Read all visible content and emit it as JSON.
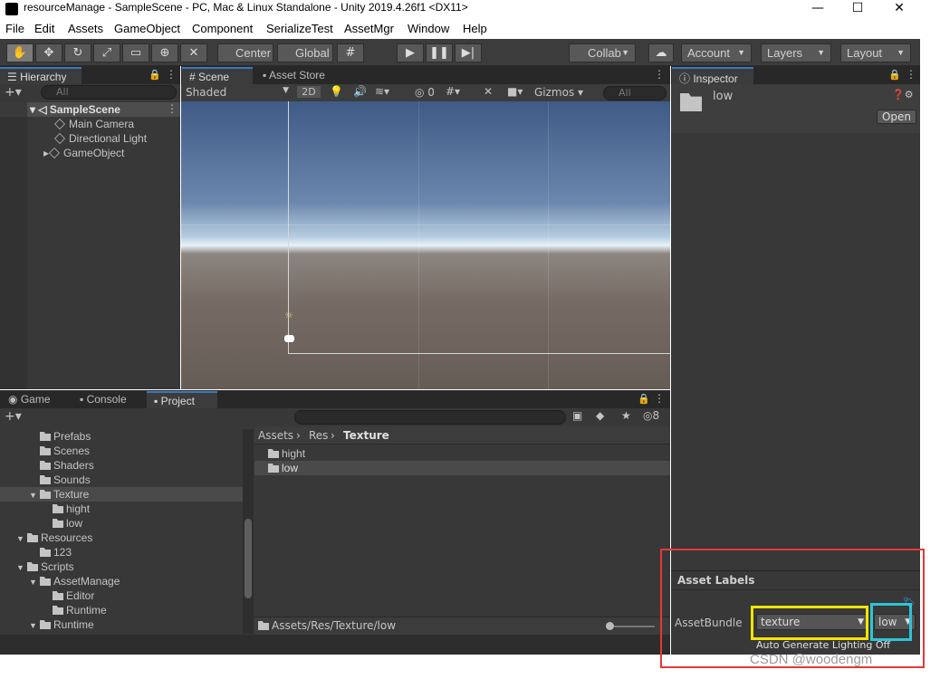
{
  "window": {
    "title": "resourceManage - SampleScene - PC, Mac & Linux Standalone - Unity 2019.4.26f1 <DX11>",
    "min": "—",
    "max": "☐",
    "close": "✕"
  },
  "menu": [
    "File",
    "Edit",
    "Assets",
    "GameObject",
    "Component",
    "SerializeTest",
    "AssetMgr",
    "Window",
    "Help"
  ],
  "toolbar": {
    "center": "Center",
    "global": "Global",
    "collab": "Collab",
    "account": "Account",
    "layers": "Layers",
    "layout": "Layout"
  },
  "hierarchy": {
    "tab": "Hierarchy",
    "search_placeholder": "All",
    "scene": "SampleScene",
    "items": [
      "Main Camera",
      "Directional Light",
      "GameObject"
    ]
  },
  "scene_tabs": {
    "scene": "Scene",
    "asset_store": "Asset Store"
  },
  "scene_toolbar": {
    "shaded": "Shaded",
    "mode_2d": "2D",
    "hidden_count": "0",
    "gizmos": "Gizmos",
    "search_placeholder": "All"
  },
  "inspector": {
    "tab": "Inspector",
    "name": "low",
    "open": "Open",
    "asset_labels": "Asset Labels",
    "assetbundle_label": "AssetBundle",
    "bundle_name": "texture",
    "variant": "low",
    "lighting": "Auto Generate Lighting Off"
  },
  "bottom_tabs": {
    "game": "Game",
    "console": "Console",
    "project": "Project",
    "hidden_count": "8"
  },
  "project_tree": [
    {
      "label": "Prefabs",
      "depth": 2,
      "fold": false
    },
    {
      "label": "Scenes",
      "depth": 2,
      "fold": false
    },
    {
      "label": "Shaders",
      "depth": 2,
      "fold": false
    },
    {
      "label": "Sounds",
      "depth": 2,
      "fold": false
    },
    {
      "label": "Texture",
      "depth": 2,
      "fold": true,
      "selected": true
    },
    {
      "label": "hight",
      "depth": 3,
      "fold": false
    },
    {
      "label": "low",
      "depth": 3,
      "fold": false
    },
    {
      "label": "Resources",
      "depth": 1,
      "fold": true
    },
    {
      "label": "123",
      "depth": 2,
      "fold": false
    },
    {
      "label": "Scripts",
      "depth": 1,
      "fold": true
    },
    {
      "label": "AssetManage",
      "depth": 2,
      "fold": true
    },
    {
      "label": "Editor",
      "depth": 3,
      "fold": false
    },
    {
      "label": "Runtime",
      "depth": 3,
      "fold": false
    },
    {
      "label": "Runtime",
      "depth": 2,
      "fold": true
    }
  ],
  "breadcrumb": [
    "Assets",
    "Res",
    "Texture"
  ],
  "project_files": [
    "hight",
    "low"
  ],
  "project_path": "Assets/Res/Texture/low",
  "watermark": "CSDN @woodengm",
  "colors": {
    "highlight_red": "#e53935",
    "highlight_yellow": "#f5e400",
    "highlight_cyan": "#2ec4d6",
    "accent": "#3a79bb"
  }
}
